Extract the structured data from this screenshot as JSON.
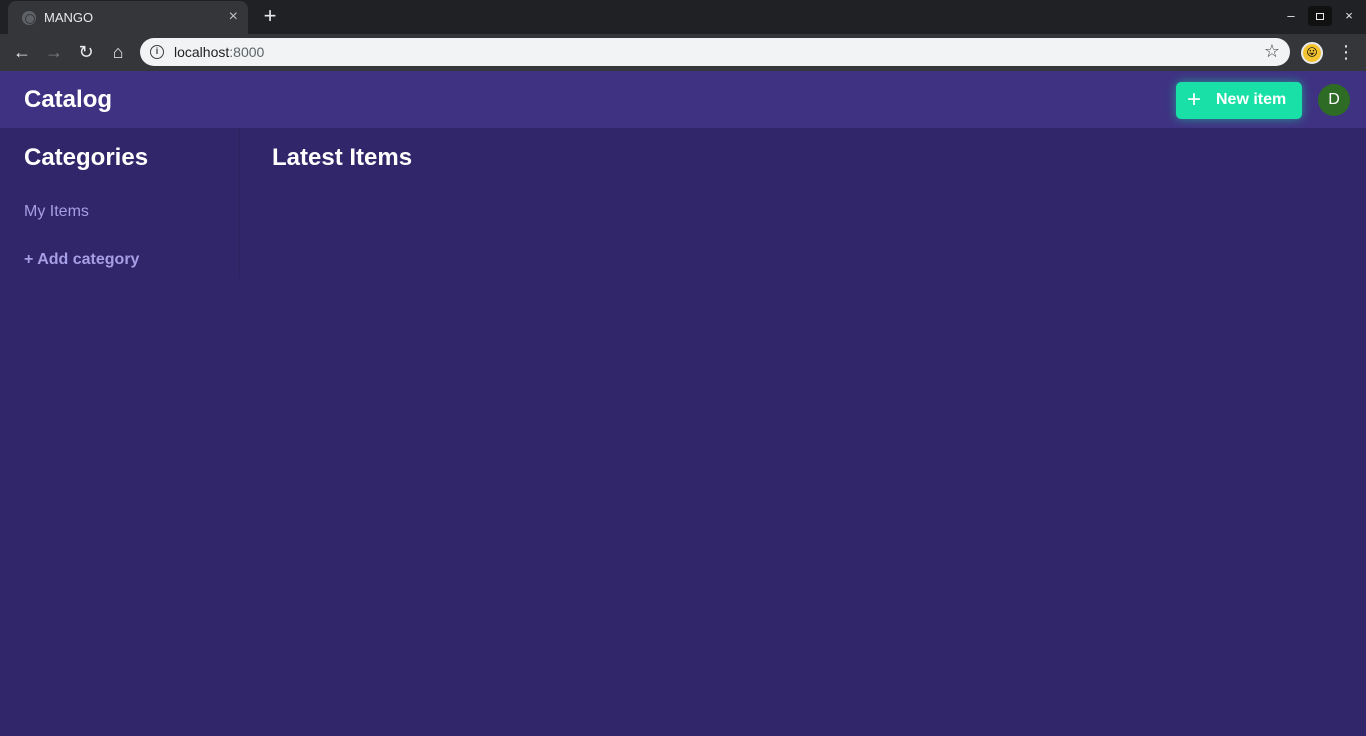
{
  "browser": {
    "tab_title": "MANGO",
    "url_host": "localhost",
    "url_port": ":8000",
    "close_tab": "×",
    "new_tab": "+"
  },
  "app": {
    "title": "Catalog",
    "new_item_label": "New item",
    "new_item_icon": "+",
    "avatar_initial": "D"
  },
  "sidebar": {
    "title": "Categories",
    "items": [
      {
        "label": "My Items"
      }
    ],
    "add_label": "+ Add category"
  },
  "main": {
    "title": "Latest Items"
  },
  "colors": {
    "page_bg": "#32266a",
    "appbar_bg": "#3f3282",
    "accent": "#19e0a7",
    "link": "#a69ee6",
    "avatar": "#2e6b24"
  }
}
